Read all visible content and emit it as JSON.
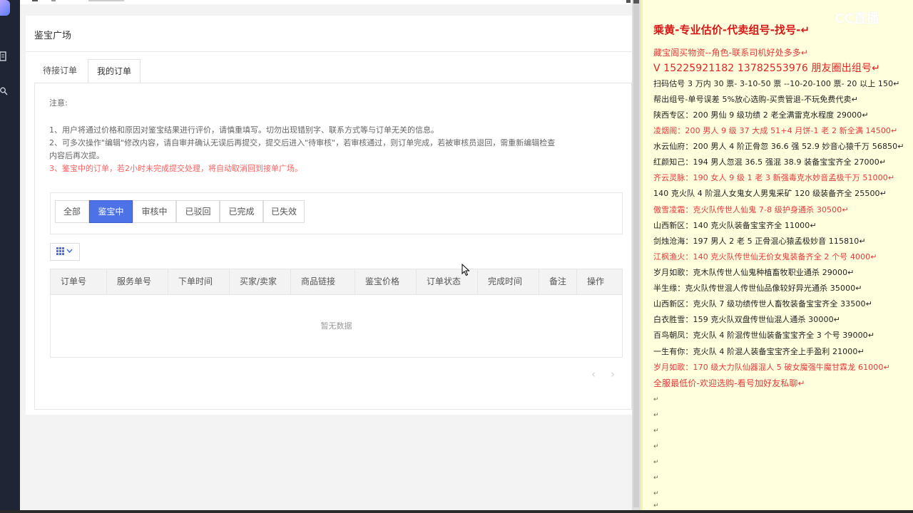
{
  "app": {
    "page_title": "鉴宝广场",
    "tabs": [
      "待接订单",
      "我的订单"
    ],
    "active_tab": 1,
    "notice": {
      "heading": "注意:",
      "lines": [
        "1、用户将通过价格和原因对鉴宝结果进行评价，请慎重填写。切勿出现错别字、联系方式等与订单无关的信息。",
        "2、可多次操作\"编辑\"修改内容，请自审并确认无误后再提交，提交后进入\"待审核\"，若审核通过，则订单完成，若被审核员退回，需重新编辑检查",
        "内容后再次提。",
        "3、鉴宝中的订单，若2小时未完成提交处理，将自动取消回到接单广场。"
      ]
    },
    "filters": [
      "全部",
      "鉴宝中",
      "审核中",
      "已驳回",
      "已完成",
      "已失效"
    ],
    "active_filter": 1,
    "columns_button_icon": "grid-icon",
    "table_headers": [
      "订单号",
      "服务单号",
      "下单时间",
      "买家/卖家",
      "商品链接",
      "鉴宝价格",
      "订单状态",
      "完成时间",
      "备注",
      "操作"
    ],
    "empty_text": "暂无数据",
    "pager": {
      "prev": "‹",
      "next": "›"
    }
  },
  "note": {
    "watermark": "CC直播",
    "title": "乘黄-专业估价-代卖组号-找号-↵",
    "lines": [
      {
        "text": "藏宝阁买物资--角色-联系司机好处多多↵",
        "style": "red"
      },
      {
        "text": "V 15225921182   13782553976 朋友圈出组号↵",
        "style": "big"
      },
      {
        "text": "扫码估号 3 万内 30 票- 3-10-50 票  --10-20-100 票- 20 以上 150↵",
        "style": "normal"
      },
      {
        "text": "帮出组号-单号误差 5%放心选购-买贵管退-不玩免费代卖↵",
        "style": "normal"
      },
      {
        "text": "陕西专区：200 男仙 9 级功绩 2 老全满雷克水程度 29000↵",
        "style": "normal"
      },
      {
        "text": "凌烟阁：200 男人 9 级 37 大成 51+4 月饼-1 老 2 新全满 14500↵",
        "style": "red"
      },
      {
        "text": "水云仙府：200 男人 4 阶正骨忽 36.6 强 52.9 妙音心猿千万 56850↵",
        "style": "normal"
      },
      {
        "text": "红颜知己：194 男人忽混 36.5 强混 38.9 装备宝宝齐全 27000↵",
        "style": "normal"
      },
      {
        "text": "齐云灵脉：190 女人 9 级 1 老 3 新强毒克水妙音孟极千万 51000↵",
        "style": "red"
      },
      {
        "text": "140 克火队 4 阶混人女鬼女人男鬼采矿 120 级装备齐全 25500↵",
        "style": "normal"
      },
      {
        "text": "傲雪凌霜：克火队传世人仙鬼 7-8 级护身通杀 30500↵",
        "style": "red"
      },
      {
        "text": "山西新区：140 克火队装备宝宝齐全 11000↵",
        "style": "normal"
      },
      {
        "text": "剑烛沧海：197 男人 2 老 5 正骨混心猿孟极妙音 115810↵",
        "style": "normal"
      },
      {
        "text": "江枫渔火：140 克火队传世仙无价女鬼装备齐全 2 个号 4000↵",
        "style": "red"
      },
      {
        "text": "岁月如歌：克木队传世人仙鬼种植畜牧职业通杀 29000↵",
        "style": "normal"
      },
      {
        "text": "半生缘：克火队传世混人传世仙品像较好异光通杀 35000↵",
        "style": "normal"
      },
      {
        "text": "山西新区：克火队 7 级功绩传世人畜牧装备宝宝齐全 33500↵",
        "style": "normal"
      },
      {
        "text": "白衣胜雪：159 克火队双盘传世仙混人通杀 30000↵",
        "style": "normal"
      },
      {
        "text": "百鸟朝凤：克火队 4 阶混传世仙装备宝宝齐全 3 个号 39000↵",
        "style": "normal"
      },
      {
        "text": "一生有你：克火队 4 阶混人装备宝宝齐全上手盈利 21000↵",
        "style": "normal"
      },
      {
        "text": "岁月如歌：170 级大力队仙器混人 5 破女魔强牛魔甘霖龙 61000↵",
        "style": "red"
      },
      {
        "text": "全服最低价-欢迎选购-看号加好友私聊↵",
        "style": "big2"
      }
    ],
    "empty_marks": [
      "↵",
      "↵",
      "↵",
      "↵",
      "↵",
      "↵",
      "↵",
      "↵"
    ]
  }
}
